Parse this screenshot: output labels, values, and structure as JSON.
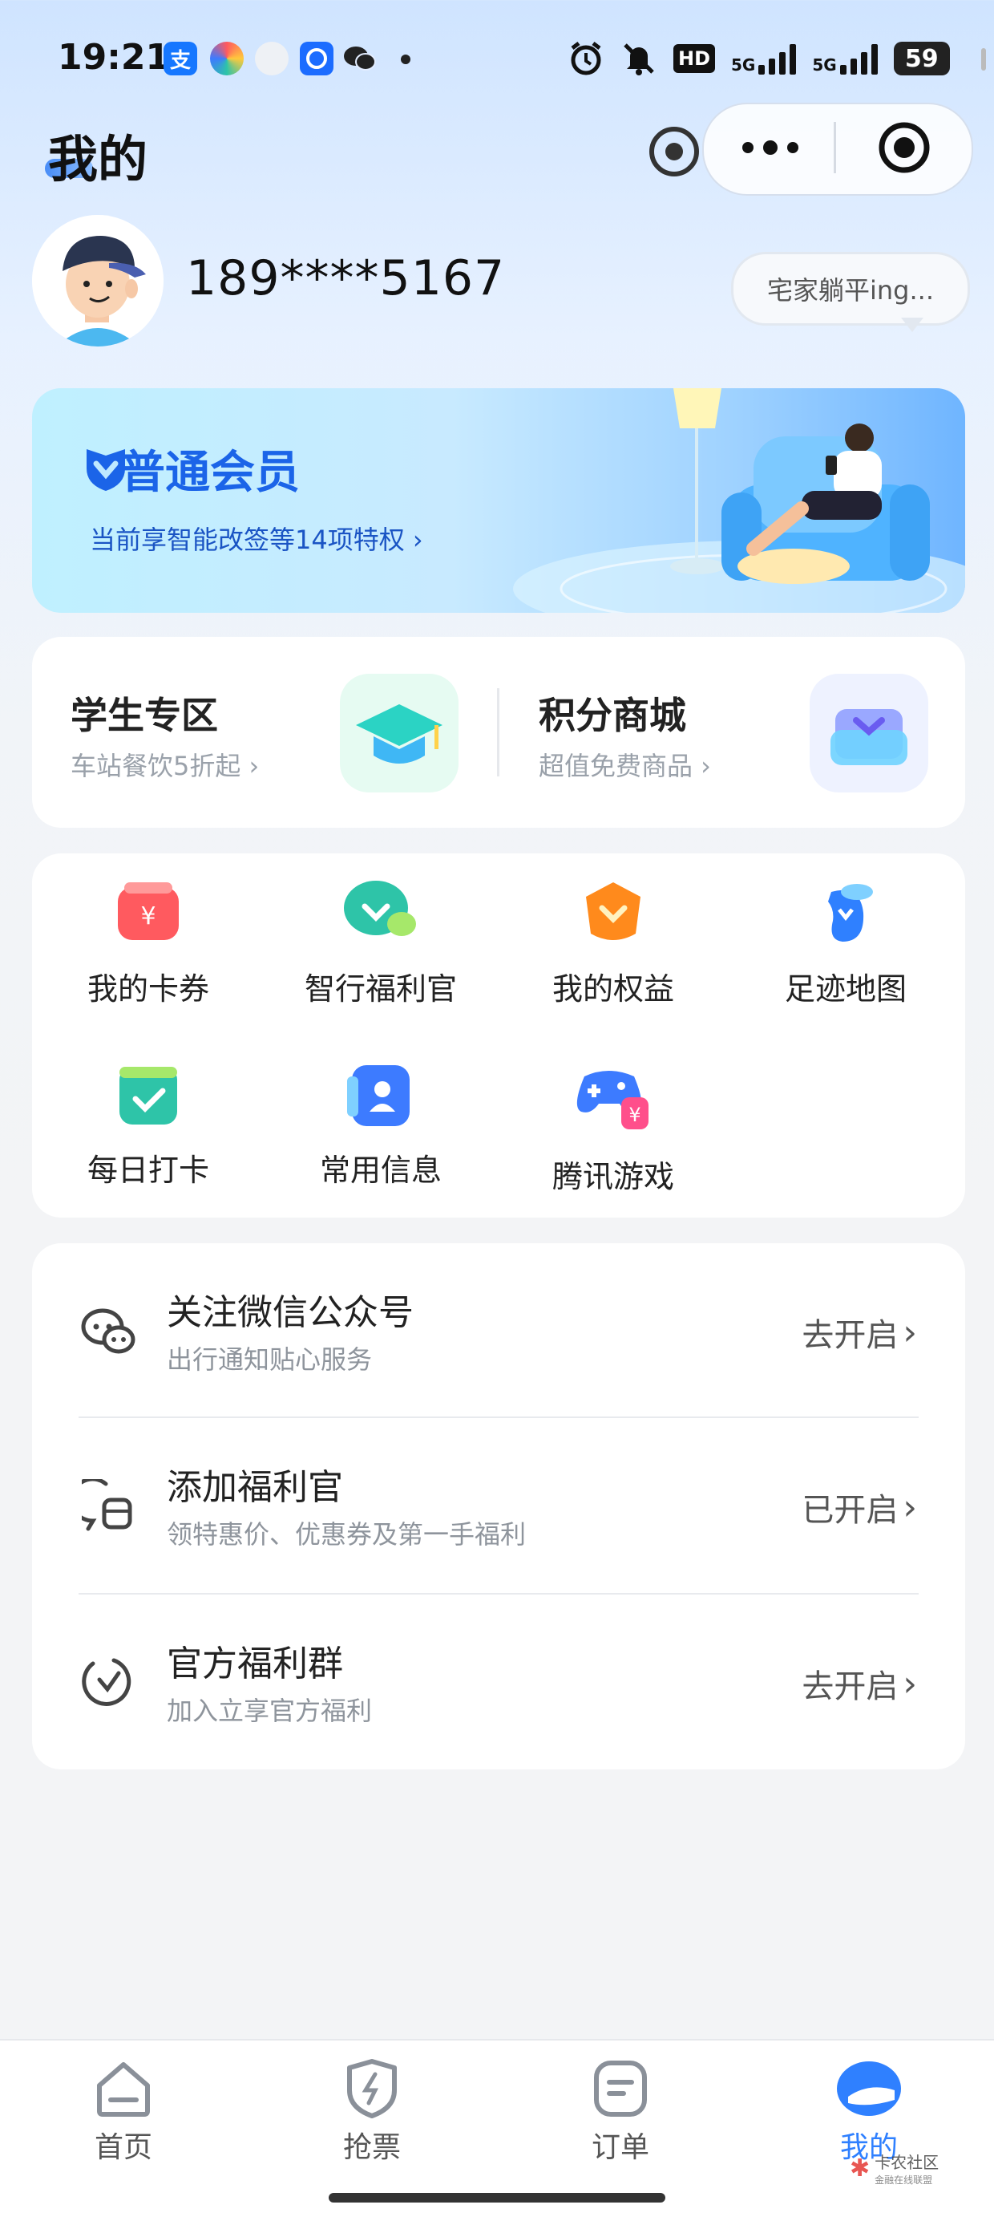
{
  "status": {
    "time": "19:21",
    "apps": [
      {
        "icon": "alipay-icon",
        "glyph": "支",
        "color": "#1677ff"
      },
      {
        "icon": "colorful-app-icon",
        "glyph": "",
        "color": "#ff6b6b"
      },
      {
        "icon": "wechat-bubble-icon",
        "glyph": "",
        "color": "#cfd6df"
      },
      {
        "icon": "blue-app-icon",
        "glyph": "",
        "color": "#1c6cff"
      },
      {
        "icon": "wechat-icon",
        "glyph": "",
        "color": "#222222"
      }
    ],
    "hd_label": "HD",
    "net_1": "5G",
    "net_2": "5G",
    "battery": "59"
  },
  "header": {
    "title": "我的"
  },
  "profile": {
    "phone": "189****5167",
    "status_bubble": "宅家躺平ing..."
  },
  "member": {
    "title": "普通会员",
    "subtitle": "当前享智能改签等14项特权 ›"
  },
  "promos": [
    {
      "title": "学生专区",
      "sub": "车站餐饮5折起 ›",
      "icon": "graduation-cap-icon"
    },
    {
      "title": "积分商城",
      "sub": "超值免费商品 ›",
      "icon": "gift-box-icon"
    }
  ],
  "grid": [
    {
      "label": "我的卡券",
      "icon": "coupon-icon",
      "color": "#ff5a5f"
    },
    {
      "label": "智行福利官",
      "icon": "chat-heart-icon",
      "color": "#2ec4a8"
    },
    {
      "label": "我的权益",
      "icon": "crown-icon",
      "color": "#ff8a1c"
    },
    {
      "label": "足迹地图",
      "icon": "footprint-icon",
      "color": "#2f80ff"
    },
    {
      "label": "每日打卡",
      "icon": "checkin-icon",
      "color": "#2ec4a8"
    },
    {
      "label": "常用信息",
      "icon": "contact-card-icon",
      "color": "#3d7bff"
    },
    {
      "label": "腾讯游戏",
      "icon": "gamepad-icon",
      "color": "#3d7bff"
    }
  ],
  "services": [
    {
      "title": "关注微信公众号",
      "sub": "出行通知贴心服务",
      "action": "去开启",
      "icon": "wechat-outline-icon"
    },
    {
      "title": "添加福利官",
      "sub": "领特惠价、优惠券及第一手福利",
      "action": "已开启",
      "icon": "chat-user-icon"
    },
    {
      "title": "官方福利群",
      "sub": "加入立享官方福利",
      "action": "去开启",
      "icon": "group-clock-icon"
    }
  ],
  "tabs": [
    {
      "label": "首页",
      "icon": "home-icon",
      "active": false
    },
    {
      "label": "抢票",
      "icon": "shield-bolt-icon",
      "active": false
    },
    {
      "label": "订单",
      "icon": "order-icon",
      "active": false
    },
    {
      "label": "我的",
      "icon": "profile-active-icon",
      "active": true
    }
  ],
  "watermark": {
    "text": "卡农社区",
    "sub": "金融在线联盟"
  }
}
